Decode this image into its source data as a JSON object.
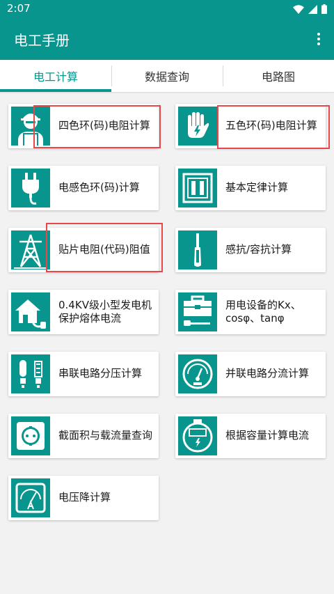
{
  "status_bar": {
    "time": "2:07"
  },
  "app_bar": {
    "title": "电工手册",
    "menu_icon": "more-vert-icon"
  },
  "tabs": [
    {
      "label": "电工计算",
      "active": true
    },
    {
      "label": "数据查询",
      "active": false
    },
    {
      "label": "电路图",
      "active": false
    }
  ],
  "cards": [
    {
      "label": "四色环(码)电阻计算",
      "icon": "worker-icon"
    },
    {
      "label": "五色环(码)电阻计算",
      "icon": "hand-shock-icon"
    },
    {
      "label": "电感色环(码)计算",
      "icon": "plug-icon"
    },
    {
      "label": "基本定律计算",
      "icon": "circuit-breaker-icon"
    },
    {
      "label": "贴片电阻(代码)阻值",
      "icon": "power-tower-icon"
    },
    {
      "label": "感抗/容抗计算",
      "icon": "screwdriver-icon"
    },
    {
      "label": "0.4KV级小型发电机保护熔体电流",
      "icon": "house-plug-icon"
    },
    {
      "label": "用电设备的Kx、cosφ、tanφ",
      "icon": "toolbox-icon"
    },
    {
      "label": "串联电路分压计算",
      "icon": "bulbs-icon"
    },
    {
      "label": "并联电路分流计算",
      "icon": "meter-gauge-icon"
    },
    {
      "label": "截面积与载流量查询",
      "icon": "socket-icon"
    },
    {
      "label": "根据容量计算电流",
      "icon": "electric-meter-icon"
    },
    {
      "label": "电压降计算",
      "icon": "ammeter-icon"
    }
  ],
  "colors": {
    "primary": "#08958e",
    "highlight": "#e8474b",
    "background": "#f2f2f2"
  }
}
